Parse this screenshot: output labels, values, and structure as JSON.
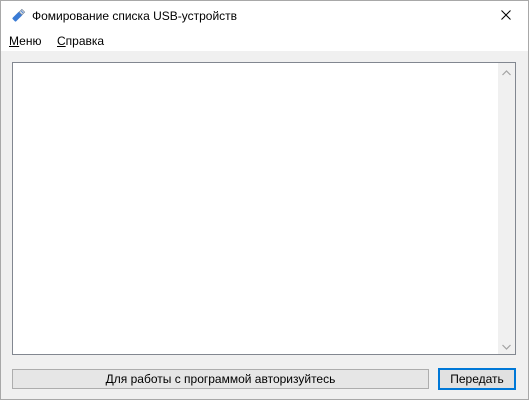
{
  "window": {
    "title": "Фомирование списка USB-устройств",
    "app_icon": "usb-drive-icon",
    "close_icon": "close-icon"
  },
  "menu": {
    "items": [
      {
        "label_first": "М",
        "label_rest": "еню"
      },
      {
        "label_first": "С",
        "label_rest": "правка"
      }
    ]
  },
  "device_list": {
    "items": [],
    "scroll_up_icon": "chevron-up-icon",
    "scroll_down_icon": "chevron-down-icon"
  },
  "footer": {
    "status_text": "Для работы с программой авторизуйтесь",
    "send_label": "Передать"
  },
  "colors": {
    "accent": "#0078d7",
    "window_bg": "#f0f0f0",
    "list_bg": "#ffffff"
  }
}
